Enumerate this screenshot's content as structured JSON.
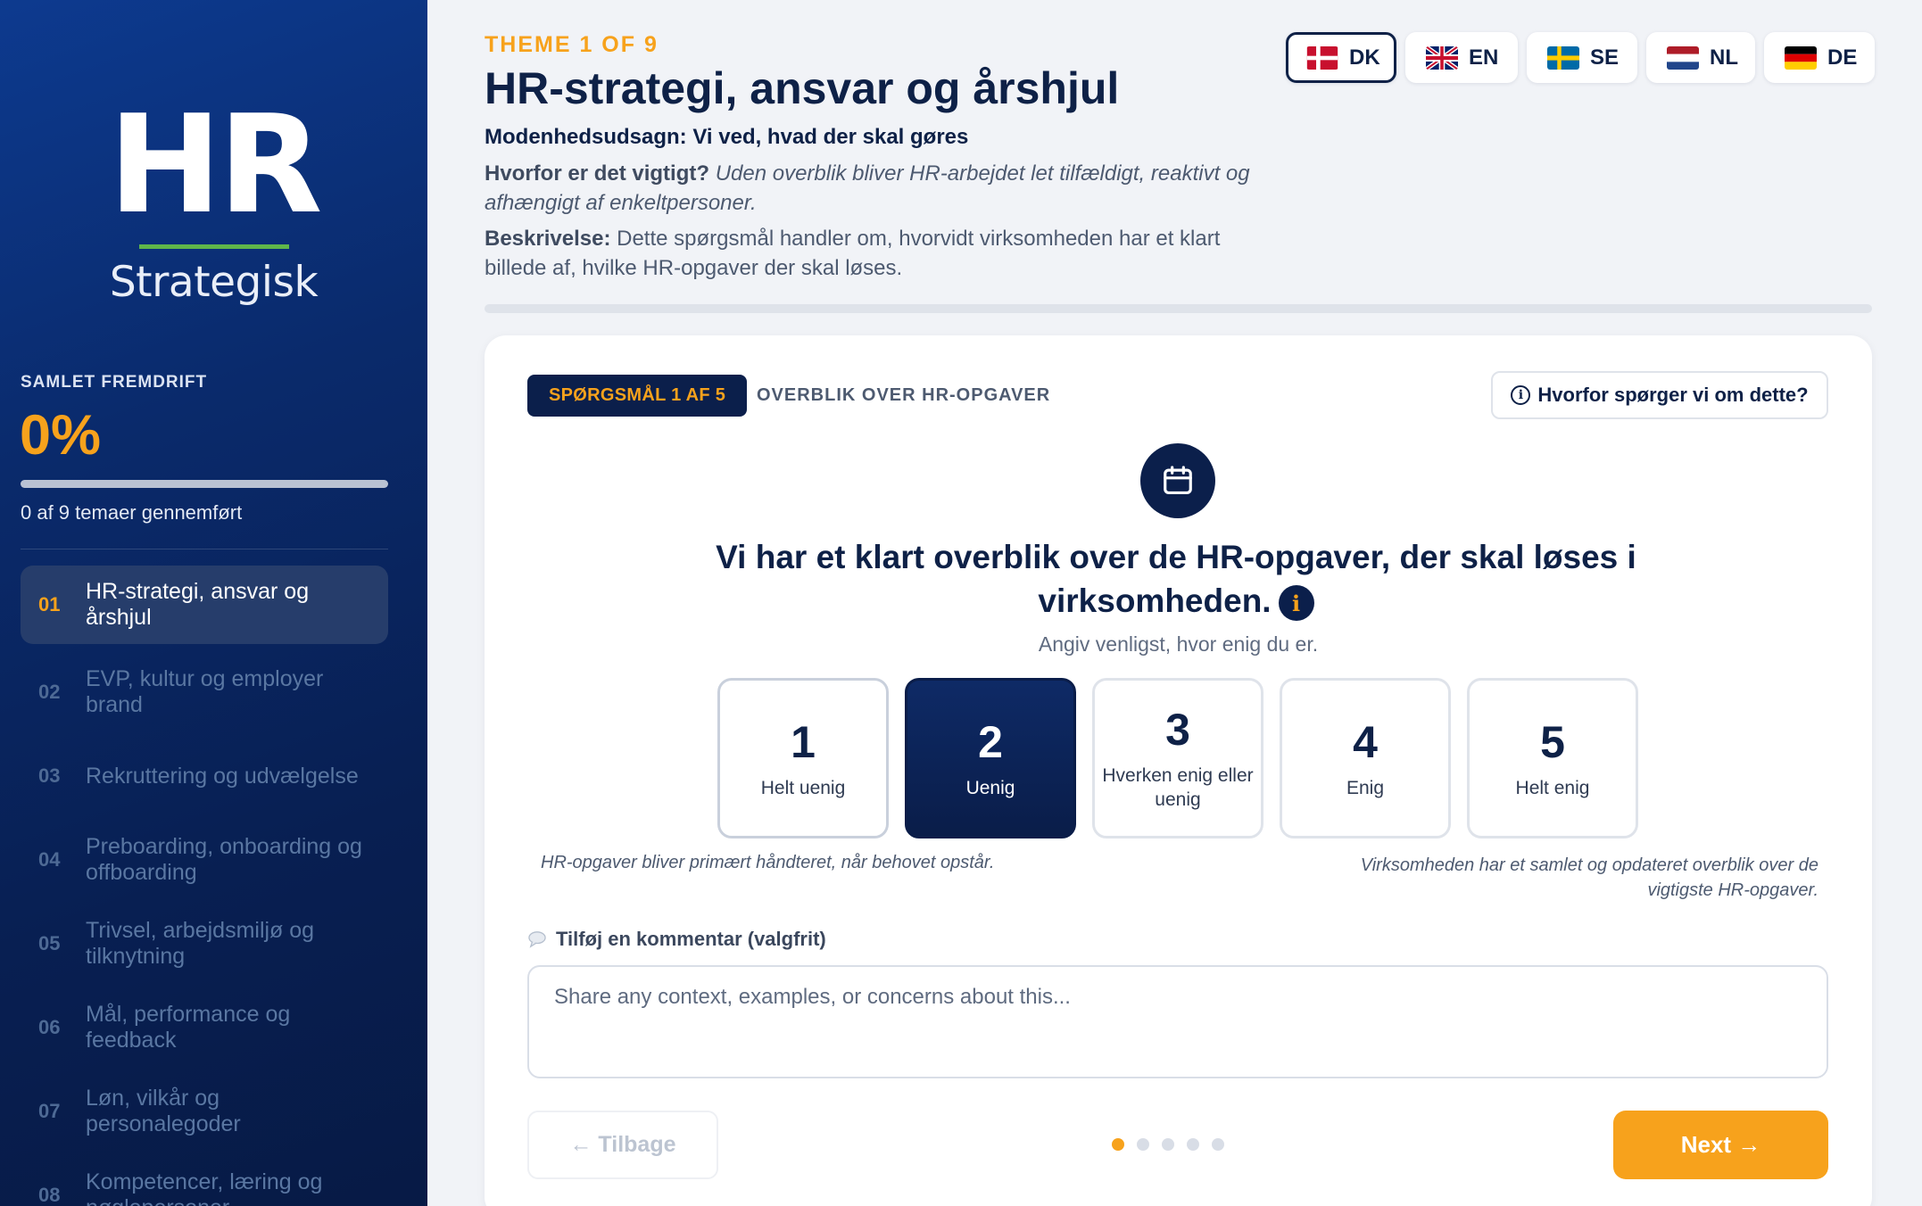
{
  "sidebar": {
    "logo_main": "HR",
    "logo_sub": "Strategisk",
    "progress_label": "SAMLET FREMDRIFT",
    "progress_pct": "0%",
    "progress_fraction": 0,
    "progress_sub": "0 af 9 temaer gennemført",
    "items": [
      {
        "num": "01",
        "label": "HR-strategi, ansvar og årshjul",
        "active": true
      },
      {
        "num": "02",
        "label": "EVP, kultur og employer brand"
      },
      {
        "num": "03",
        "label": "Rekruttering og udvælgelse"
      },
      {
        "num": "04",
        "label": "Preboarding, onboarding og offboarding"
      },
      {
        "num": "05",
        "label": "Trivsel, arbejdsmiljø og tilknytning"
      },
      {
        "num": "06",
        "label": "Mål, performance og feedback"
      },
      {
        "num": "07",
        "label": "Løn, vilkår og personalegoder"
      },
      {
        "num": "08",
        "label": "Kompetencer, læring og nøglepersoner"
      }
    ]
  },
  "header": {
    "theme_label": "THEME 1 OF 9",
    "title": "HR-strategi, ansvar og årshjul",
    "statement": "Modenhedsudsagn: Vi ved, hvad der skal gøres",
    "why_label": "Hvorfor er det vigtigt?",
    "why_text": "Uden overblik bliver HR-arbejdet let tilfældigt, reaktivt og afhængigt af enkeltpersoner.",
    "desc_label": "Beskrivelse:",
    "desc_text": "Dette spørgsmål handler om, hvorvidt virksomheden har et klart billede af, hvilke HR-opgaver der skal løses."
  },
  "languages": [
    {
      "code": "DK",
      "flag": "denmark-flag-icon",
      "active": true
    },
    {
      "code": "EN",
      "flag": "uk-flag-icon"
    },
    {
      "code": "SE",
      "flag": "sweden-flag-icon"
    },
    {
      "code": "NL",
      "flag": "netherlands-flag-icon"
    },
    {
      "code": "DE",
      "flag": "germany-flag-icon"
    }
  ],
  "question": {
    "badge": "SPØRGSMÅL 1 AF 5",
    "topic": "OVERBLIK OVER HR-OPGAVER",
    "why_button": "Hvorfor spørger vi om dette?",
    "why_button_icon": "i",
    "icon": "calendar-icon",
    "text": "Vi har et klart overblik over de HR-opgaver, der skal løses i virksomheden.",
    "info_icon": "i",
    "hint": "Angiv venligst, hvor enig du er.",
    "options": [
      {
        "n": "1",
        "t": "Helt uenig"
      },
      {
        "n": "2",
        "t": "Uenig",
        "selected": true
      },
      {
        "n": "3",
        "t": "Hverken enig eller uenig"
      },
      {
        "n": "4",
        "t": "Enig"
      },
      {
        "n": "5",
        "t": "Helt enig"
      }
    ],
    "anchor_left": "HR-opgaver bliver primært håndteret, når behovet opstår.",
    "anchor_right": "Virksomheden har et samlet og opdateret overblik over de vigtigste HR-opgaver.",
    "comment_label": "Tilføj en kommentar (valgfrit)",
    "comment_placeholder": "Share any context, examples, or concerns about this...",
    "back_label": "← Tilbage",
    "next_label": "Next →",
    "current_step": 1,
    "total_steps": 5
  },
  "colors": {
    "accent": "#f7a21c",
    "navy": "#0b1f4b",
    "success": "#5fb64a"
  }
}
